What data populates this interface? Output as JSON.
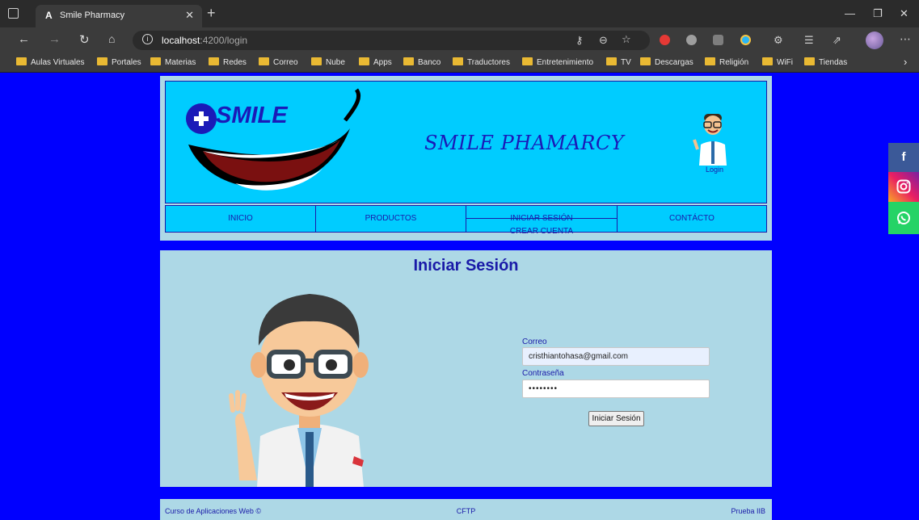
{
  "browser": {
    "tab_title": "Smile Pharmacy",
    "tab_favicon": "A",
    "url_host": "localhost",
    "url_path": ":4200/login",
    "bookmarks": [
      "Aulas Virtuales",
      "Portales",
      "Materias",
      "Redes",
      "Correo",
      "Nube",
      "Apps",
      "Banco",
      "Traductores",
      "Entretenimiento",
      "TV",
      "Descargas",
      "Religión",
      "WiFi",
      "Tiendas"
    ]
  },
  "header": {
    "logo_text": "SMILE",
    "site_title": "SMILE PHAMARCY",
    "login_link": "Login"
  },
  "nav": {
    "home": "INICIO",
    "products": "PRODUCTOS",
    "login": "INICIAR SESIÓN",
    "register": "CREAR CUENTA",
    "contact": "CONTÁCTO"
  },
  "login": {
    "heading": "Iniciar Sesión",
    "email_label": "Correo",
    "email_value": "cristhiantohasa@gmail.com",
    "password_label": "Contraseña",
    "password_value": "••••••••",
    "submit_label": "Iniciar Sesión"
  },
  "footer": {
    "left": "Curso de Aplicaciones Web ©",
    "center": "CFTP",
    "right": "Prueba IIB"
  },
  "social": {
    "facebook_glyph": "f",
    "colors": {
      "facebook": "#3b5998",
      "whatsapp": "#25d366"
    }
  }
}
